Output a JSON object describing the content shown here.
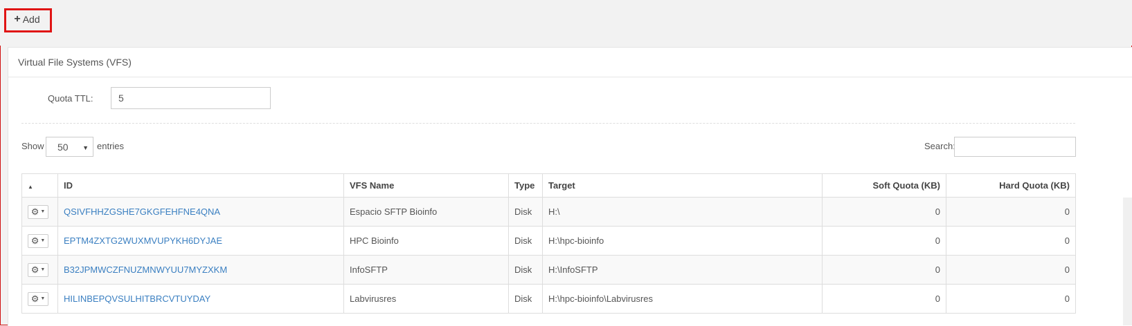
{
  "toolbar": {
    "add_label": "Add"
  },
  "panel": {
    "title": "Virtual File Systems (VFS)"
  },
  "quota": {
    "label": "Quota TTL:",
    "value": "5"
  },
  "listing": {
    "show_label": "Show",
    "page_size": "50",
    "entries_label": "entries",
    "search_label": "Search:",
    "search_value": ""
  },
  "table": {
    "columns": {
      "id": "ID",
      "vfs_name": "VFS Name",
      "type": "Type",
      "target": "Target",
      "soft_quota": "Soft Quota (KB)",
      "hard_quota": "Hard Quota (KB)"
    },
    "rows": [
      {
        "id": "QSIVFHHZGSHE7GKGFEHFNE4QNA",
        "name": "Espacio SFTP Bioinfo",
        "type": "Disk",
        "target": "H:\\",
        "soft": "0",
        "hard": "0"
      },
      {
        "id": "EPTM4ZXTG2WUXMVUPYKH6DYJAE",
        "name": "HPC Bioinfo",
        "type": "Disk",
        "target": "H:\\hpc-bioinfo",
        "soft": "0",
        "hard": "0"
      },
      {
        "id": "B32JPMWCZFNUZMNWYUU7MYZXKM",
        "name": "InfoSFTP",
        "type": "Disk",
        "target": "H:\\InfoSFTP",
        "soft": "0",
        "hard": "0"
      },
      {
        "id": "HILINBEPQVSULHITBRCVTUYDAY",
        "name": "Labvirusres",
        "type": "Disk",
        "target": "H:\\hpc-bioinfo\\Labvirusres",
        "soft": "0",
        "hard": "0"
      }
    ]
  },
  "colors": {
    "link": "#3a7fc1",
    "highlight": "#e01414"
  },
  "icons": {
    "add": "plus-icon",
    "row_action": "gear-icon",
    "sort": "sort-up-icon"
  }
}
